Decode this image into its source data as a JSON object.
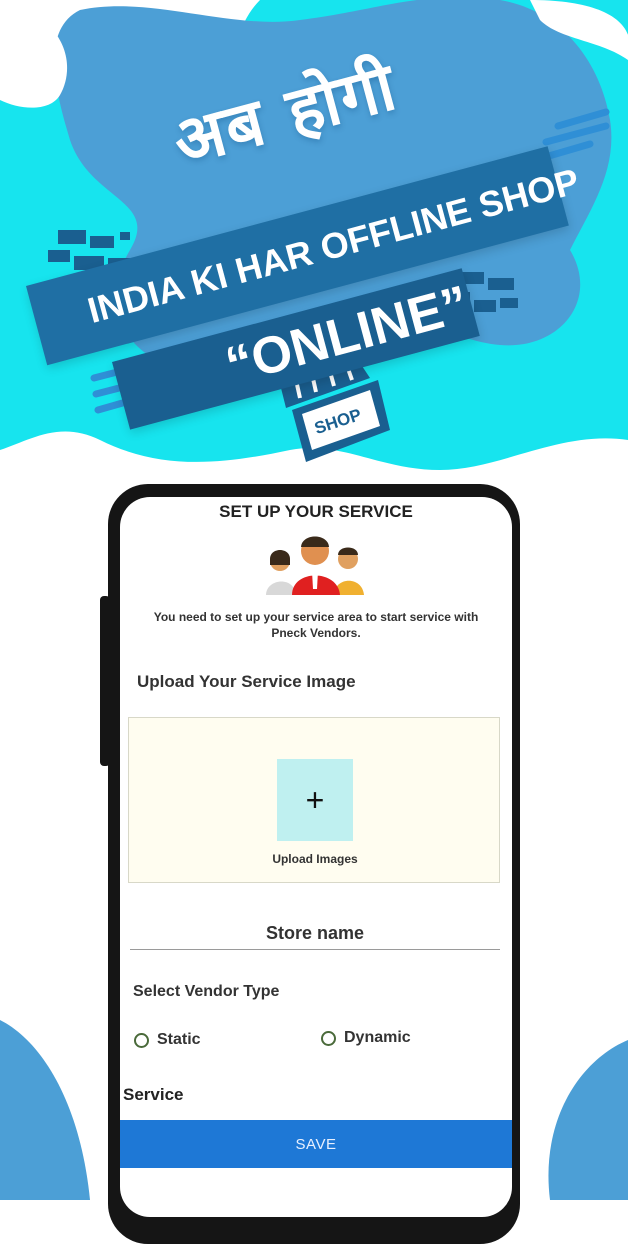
{
  "promo": {
    "hindi_text": "अब होगी",
    "line1": "INDIA KI HAR OFFLINE SHOP",
    "line2": "“ONLINE”",
    "shop_sign": "SHOP"
  },
  "screen": {
    "title": "SET UP YOUR SERVICE",
    "intro": "You need to set up your service area to start service with Pneck Vendors.",
    "upload_label": "Upload Your Service Image",
    "upload_plus": "+",
    "upload_images": "Upload Images",
    "store_placeholder": "Store name",
    "vendor_type_label": "Select Vendor Type",
    "options": [
      "Static",
      "Dynamic"
    ],
    "service_label": "Service",
    "save_label": "SAVE"
  },
  "colors": {
    "cyan": "#16e6ee",
    "blue": "#1f6fa4",
    "save_button": "#1e78d6"
  }
}
